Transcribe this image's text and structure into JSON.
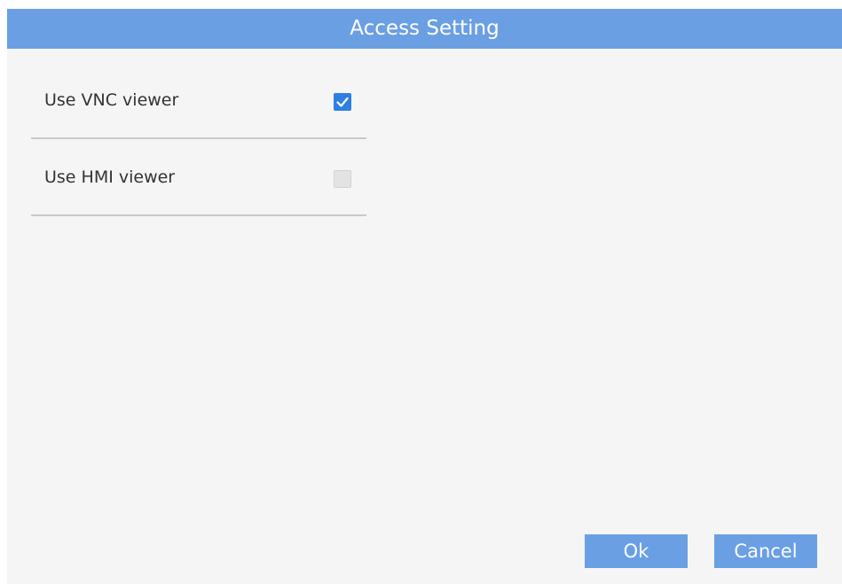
{
  "dialog": {
    "title": "Access Setting",
    "options": [
      {
        "label": "Use VNC viewer",
        "checked": true
      },
      {
        "label": "Use HMI viewer",
        "checked": false
      }
    ],
    "buttons": {
      "ok_label": "Ok",
      "cancel_label": "Cancel"
    }
  },
  "colors": {
    "titlebar": "#6a9fe3",
    "button": "#6a9fe3",
    "checkbox_checked": "#2f7fe0",
    "checkbox_unchecked": "#e3e3e3",
    "background": "#f5f5f5"
  },
  "icons": {
    "checked": "checkmark-icon"
  }
}
